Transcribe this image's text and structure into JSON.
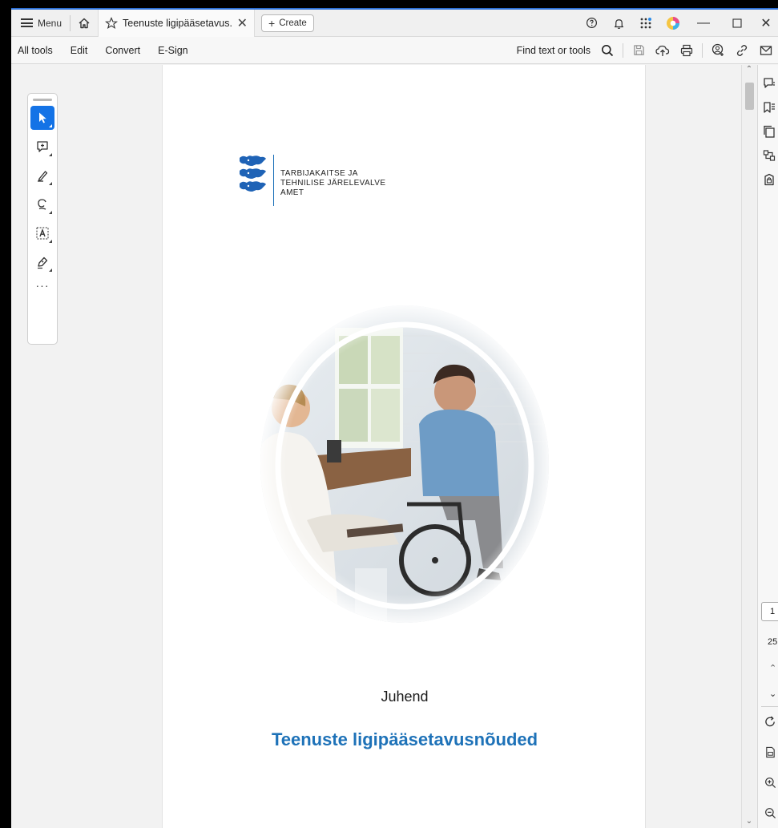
{
  "tabbar": {
    "menu_label": "Menu",
    "tab_title": "Teenuste ligipääsetavus...",
    "create_label": "Create"
  },
  "toolbar": {
    "items": [
      "All tools",
      "Edit",
      "Convert",
      "E-Sign"
    ],
    "find_label": "Find text or tools"
  },
  "document": {
    "agency_line1": "TARBIJAKAITSE JA",
    "agency_line2": "TEHNILISE JÄRELEVALVE",
    "agency_line3": "AMET",
    "subtitle": "Juhend",
    "title": "Teenuste ligipääsetavusnõuded"
  },
  "navigation": {
    "current_page": "1",
    "total_pages": "25"
  },
  "colors": {
    "accent": "#1473e6",
    "title_blue": "#1e72b8",
    "frame_border": "#2c6fd4"
  }
}
